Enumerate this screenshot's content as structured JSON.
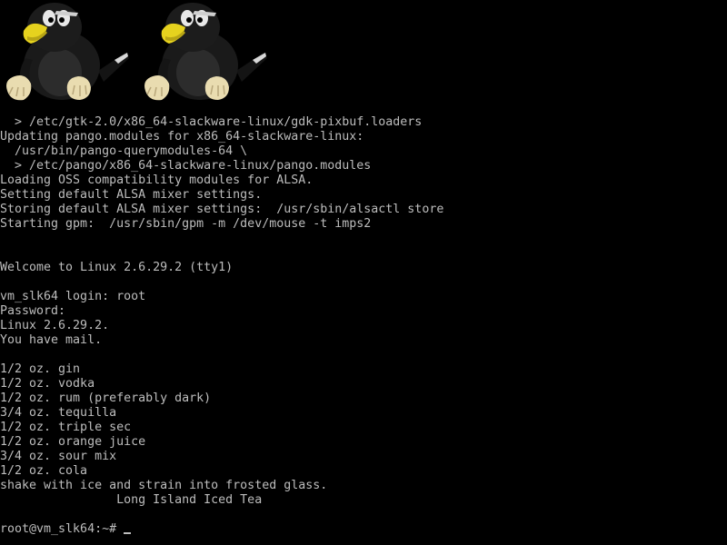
{
  "boot_logo": {
    "icon": "tux-penguin-icon",
    "count": 2
  },
  "terminal": {
    "lines": [
      "  > /etc/gtk-2.0/x86_64-slackware-linux/gdk-pixbuf.loaders",
      "Updating pango.modules for x86_64-slackware-linux:",
      "  /usr/bin/pango-querymodules-64 \\",
      "  > /etc/pango/x86_64-slackware-linux/pango.modules",
      "Loading OSS compatibility modules for ALSA.",
      "Setting default ALSA mixer settings.",
      "Storing default ALSA mixer settings:  /usr/sbin/alsactl store",
      "Starting gpm:  /usr/sbin/gpm -m /dev/mouse -t imps2",
      "",
      "",
      "Welcome to Linux 2.6.29.2 (tty1)",
      "",
      "vm_slk64 login: root",
      "Password:",
      "Linux 2.6.29.2.",
      "You have mail.",
      "",
      "1/2 oz. gin",
      "1/2 oz. vodka",
      "1/2 oz. rum (preferably dark)",
      "3/4 oz. tequilla",
      "1/2 oz. triple sec",
      "1/2 oz. orange juice",
      "3/4 oz. sour mix",
      "1/2 oz. cola",
      "shake with ice and strain into frosted glass.",
      "                Long Island Iced Tea"
    ],
    "prompt": "root@vm_slk64:~# "
  },
  "colors": {
    "background": "#000000",
    "text": "#bdbdbd"
  }
}
